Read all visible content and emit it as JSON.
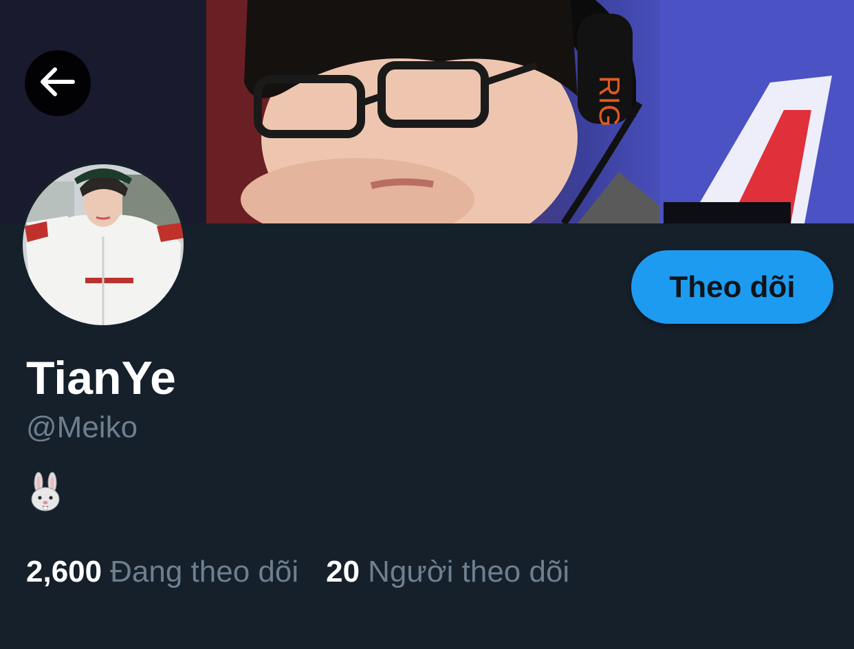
{
  "profile": {
    "display_name": "TianYe",
    "handle": "@Meiko",
    "bio_icon": "rabbit-face-emoji"
  },
  "actions": {
    "follow_label": "Theo dõi",
    "back_icon": "arrow-left-icon"
  },
  "stats": {
    "following_count": "2,600",
    "following_label": "Đang theo dõi",
    "followers_count": "20",
    "followers_label": "Người theo dõi"
  },
  "colors": {
    "background": "#15202b",
    "accent": "#1d9bf0",
    "secondary_text": "#6e7f8f",
    "primary_text": "#ffffff"
  }
}
